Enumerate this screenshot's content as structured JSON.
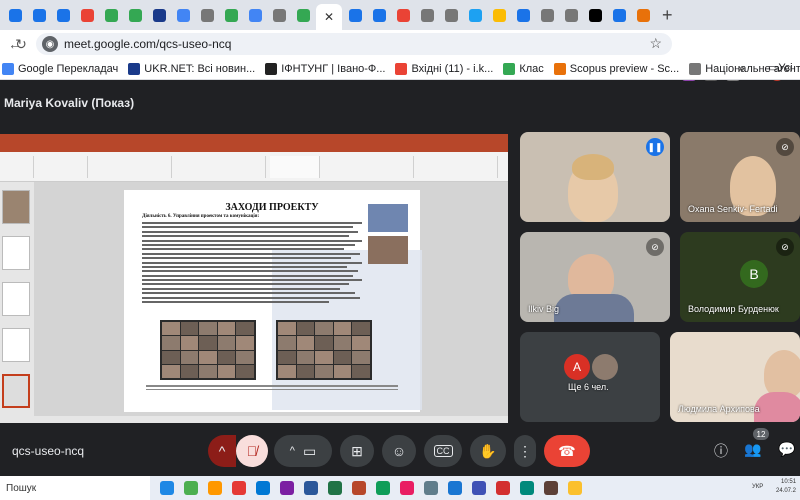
{
  "browser": {
    "tabs": [
      {
        "color": "#1a73e8"
      },
      {
        "color": "#1a73e8"
      },
      {
        "color": "#1a73e8"
      },
      {
        "color": "#ea4335"
      },
      {
        "color": "#34a853"
      },
      {
        "color": "#34a853"
      },
      {
        "color": "#1a3a8a"
      },
      {
        "color": "#4285f4"
      },
      {
        "color": "#777777"
      },
      {
        "color": "#34a853"
      },
      {
        "color": "#4285f4"
      },
      {
        "color": "#777777"
      },
      {
        "color": "#34a853"
      }
    ],
    "active_tab": {
      "close_label": "✕"
    },
    "tabs_after": [
      {
        "color": "#1a73e8"
      },
      {
        "color": "#1a73e8"
      },
      {
        "color": "#ea4335"
      },
      {
        "color": "#777777"
      },
      {
        "color": "#777777"
      },
      {
        "color": "#1da1f2"
      },
      {
        "color": "#fbbc04"
      },
      {
        "color": "#1a73e8"
      },
      {
        "color": "#777777"
      },
      {
        "color": "#777777"
      },
      {
        "color": "#000000"
      },
      {
        "color": "#1a73e8"
      },
      {
        "color": "#e8710a"
      }
    ],
    "new_tab_label": "+",
    "url": "meet.google.com/qcs-useo-ncq",
    "site_icon_letter": "◉",
    "bookmarks": [
      {
        "label": "Google Перекладач",
        "color": "#4285f4"
      },
      {
        "label": "UKR.NET: Всі новин...",
        "color": "#1a3a8a"
      },
      {
        "label": "ІФНТУНГ | Івано-Ф...",
        "color": "#222222"
      },
      {
        "label": "Вхідні (11) - i.k...",
        "color": "#ea4335"
      },
      {
        "label": "Клас",
        "color": "#34a853"
      },
      {
        "label": "Scopus preview - Sc...",
        "color": "#e8710a"
      },
      {
        "label": "Національне агент...",
        "color": "#777777"
      }
    ],
    "bookmarks_more": "»",
    "bookmarks_folder": "Усі"
  },
  "meet": {
    "presenter_label": "Mariya Kovaliv (Показ)",
    "meeting_code": "qcs-useo-ncq",
    "participants_count": "12",
    "participants": [
      {
        "name": "",
        "mic_state": "speaking"
      },
      {
        "name": "Oxana Senkiv- Fertadi",
        "mic_state": "muted"
      },
      {
        "name": "Ilkiv Big",
        "mic_state": "muted"
      },
      {
        "name": "Володимир Бурденюк",
        "avatar_letter": "В",
        "avatar_color": "#33691e",
        "mic_state": "muted"
      },
      {
        "name": "Ще 6 чел.",
        "avatar_letter": "A",
        "avatar_color": "#d93025"
      },
      {
        "name": "Людмила Архипова"
      }
    ]
  },
  "slide": {
    "title": "ЗАХОДИ ПРОЕКТУ",
    "subtitle": "Діяльність 6. Управління проектом та комунікація:"
  },
  "taskbar": {
    "search_label": "Пошук",
    "tray_lang": "УКР",
    "time": "10:51",
    "date": "24.07.2"
  }
}
